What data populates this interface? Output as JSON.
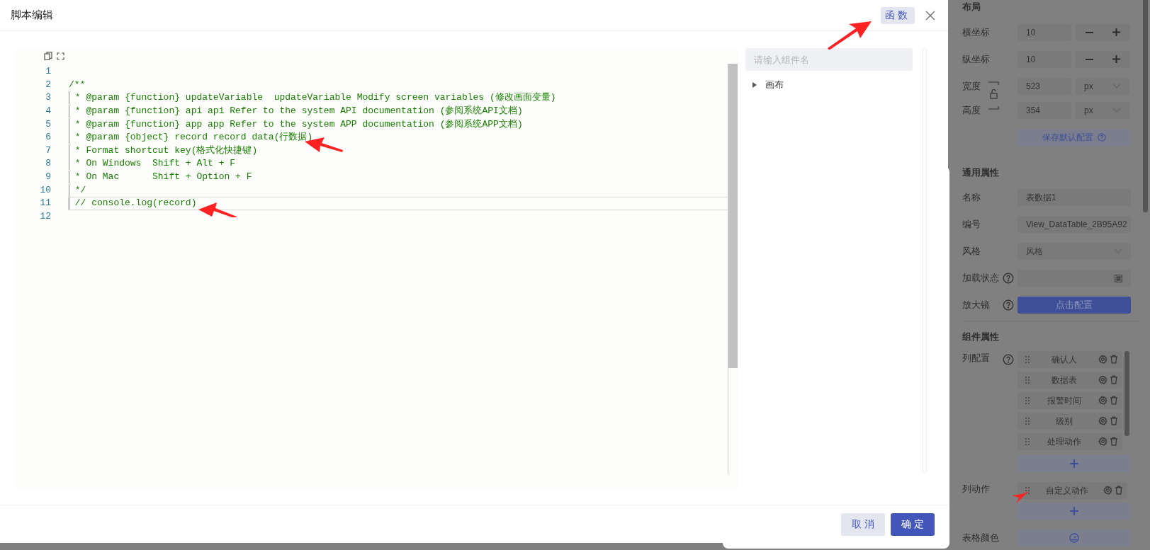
{
  "dialog": {
    "title": "脚本编辑",
    "function_button": "函数",
    "editor": {
      "lines": [
        {
          "number": "1",
          "current": false
        },
        {
          "number": "2",
          "text": "/**",
          "current": false
        },
        {
          "number": "3",
          "text": " * @param {function} updateVariable  updateVariable Modify screen variables (修改画面变量)",
          "current": false
        },
        {
          "number": "4",
          "text": " * @param {function} api api Refer to the system API documentation (参阅系统API文档)",
          "current": false
        },
        {
          "number": "5",
          "text": " * @param {function} app app Refer to the system APP documentation (参阅系统APP文档)",
          "current": false
        },
        {
          "number": "6",
          "text": " * @param {object} record record data(行数据)",
          "current": false
        },
        {
          "number": "7",
          "text": " * Format shortcut key(格式化快捷键)",
          "current": false
        },
        {
          "number": "8",
          "text": " * On Windows  Shift + Alt + F",
          "current": false
        },
        {
          "number": "9",
          "text": " * On Mac      Shift + Option + F",
          "current": false
        },
        {
          "number": "10",
          "text": " */",
          "current": false
        },
        {
          "number": "11",
          "text": " // console.log(record)",
          "current": true
        },
        {
          "number": "12",
          "current": false
        }
      ]
    },
    "component_search": {
      "placeholder": "请输入组件名"
    },
    "component_tree": [
      {
        "label": "画布",
        "expanded": false
      }
    ],
    "buttons": [
      {
        "label": "取消",
        "kind": "secondary"
      },
      {
        "label": "确定",
        "kind": "primary"
      }
    ]
  },
  "properties": {
    "layout": {
      "title": "布局",
      "position": [
        {
          "label": "横坐标",
          "value": "10"
        },
        {
          "label": "纵坐标",
          "value": "10"
        }
      ],
      "size": [
        {
          "label": "宽度",
          "value": "523",
          "unit": "px"
        },
        {
          "label": "高度",
          "value": "354",
          "unit": "px"
        }
      ],
      "save_button": "保存默认配置"
    },
    "general": {
      "title": "通用属性",
      "name": {
        "label": "名称",
        "value": "表数据1"
      },
      "id": {
        "label": "编号",
        "value": "View_DataTable_2B95A92"
      },
      "style": {
        "label": "风格",
        "placeholder": "风格"
      },
      "loading": {
        "label": "加载状态"
      },
      "magnifier": {
        "label": "放大镜",
        "button": "点击配置"
      }
    },
    "component": {
      "title": "组件属性",
      "columns": {
        "label": "列配置",
        "items": [
          "确认人",
          "数据表",
          "报警时间",
          "级别",
          "处理动作"
        ]
      },
      "column_actions": {
        "label": "列动作",
        "items": [
          "自定义动作"
        ]
      },
      "table_color": {
        "label": "表格颜色"
      }
    }
  }
}
